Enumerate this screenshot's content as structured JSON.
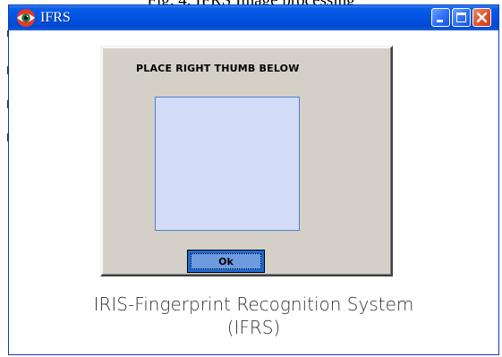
{
  "document": {
    "caption": "Fig. 4. IFRS Image processing"
  },
  "window": {
    "title": "IFRS",
    "app_icon": "eye-icon",
    "controls": {
      "minimize": "minimize-icon",
      "maximize": "maximize-icon",
      "close": "close-icon"
    }
  },
  "panel": {
    "heading": "PLACE RIGHT THUMB BELOW",
    "ok_label": "Ok"
  },
  "system_title": {
    "line1": "IRIS-Fingerprint Recognition System",
    "line2": "(IFRS)"
  },
  "colors": {
    "titlebar": "#0054e3",
    "panel": "#d4d0c8",
    "scan_area": "#d2dcf6",
    "ok_button": "#1b6bd6",
    "close_button": "#e0502a"
  }
}
